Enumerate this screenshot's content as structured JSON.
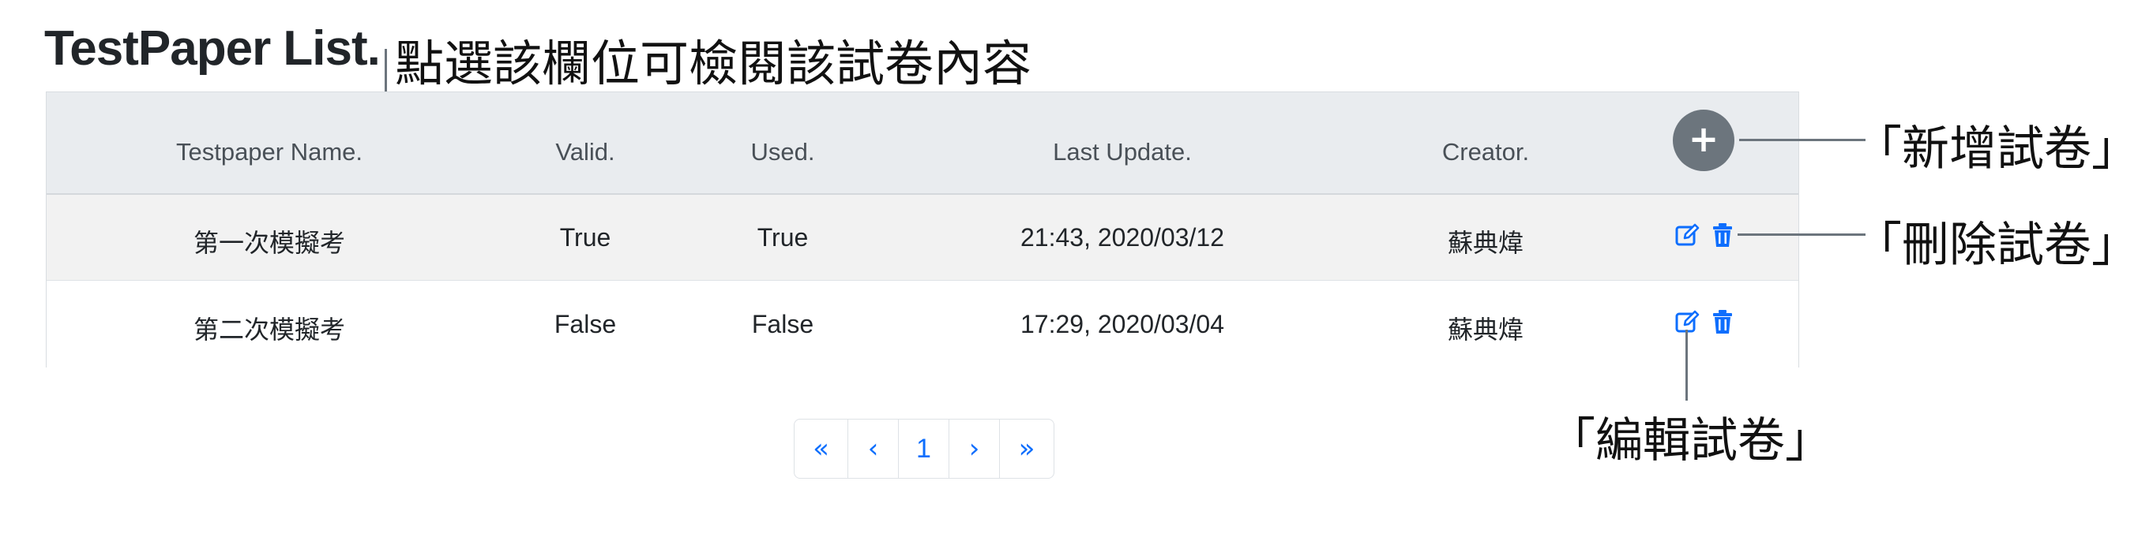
{
  "page": {
    "title": "TestPaper List."
  },
  "annotations": {
    "column_hint": "點選該欄位可檢閱該試卷內容",
    "add": "「新增試卷」",
    "delete": "「刪除試卷」",
    "edit": "「編輯試卷」"
  },
  "table": {
    "headers": {
      "name": "Testpaper Name.",
      "valid": "Valid.",
      "used": "Used.",
      "last_update": "Last Update.",
      "creator": "Creator."
    },
    "add_icon": "+",
    "rows": [
      {
        "name": "第一次模擬考",
        "valid": "True",
        "used": "True",
        "last_update": "21:43, 2020/03/12",
        "creator": "蘇典煒",
        "edit_icon": "edit-icon",
        "delete_icon": "trash-icon"
      },
      {
        "name": "第二次模擬考",
        "valid": "False",
        "used": "False",
        "last_update": "17:29, 2020/03/04",
        "creator": "蘇典煒",
        "edit_icon": "edit-icon",
        "delete_icon": "trash-icon"
      }
    ]
  },
  "pagination": {
    "first": "«",
    "prev": "‹",
    "current": "1",
    "next": "›",
    "last": "»"
  },
  "colors": {
    "accent": "#0d6efd",
    "header_bg": "#e9ecef",
    "add_button": "#6c757d",
    "annotation_line": "#6c757d"
  }
}
